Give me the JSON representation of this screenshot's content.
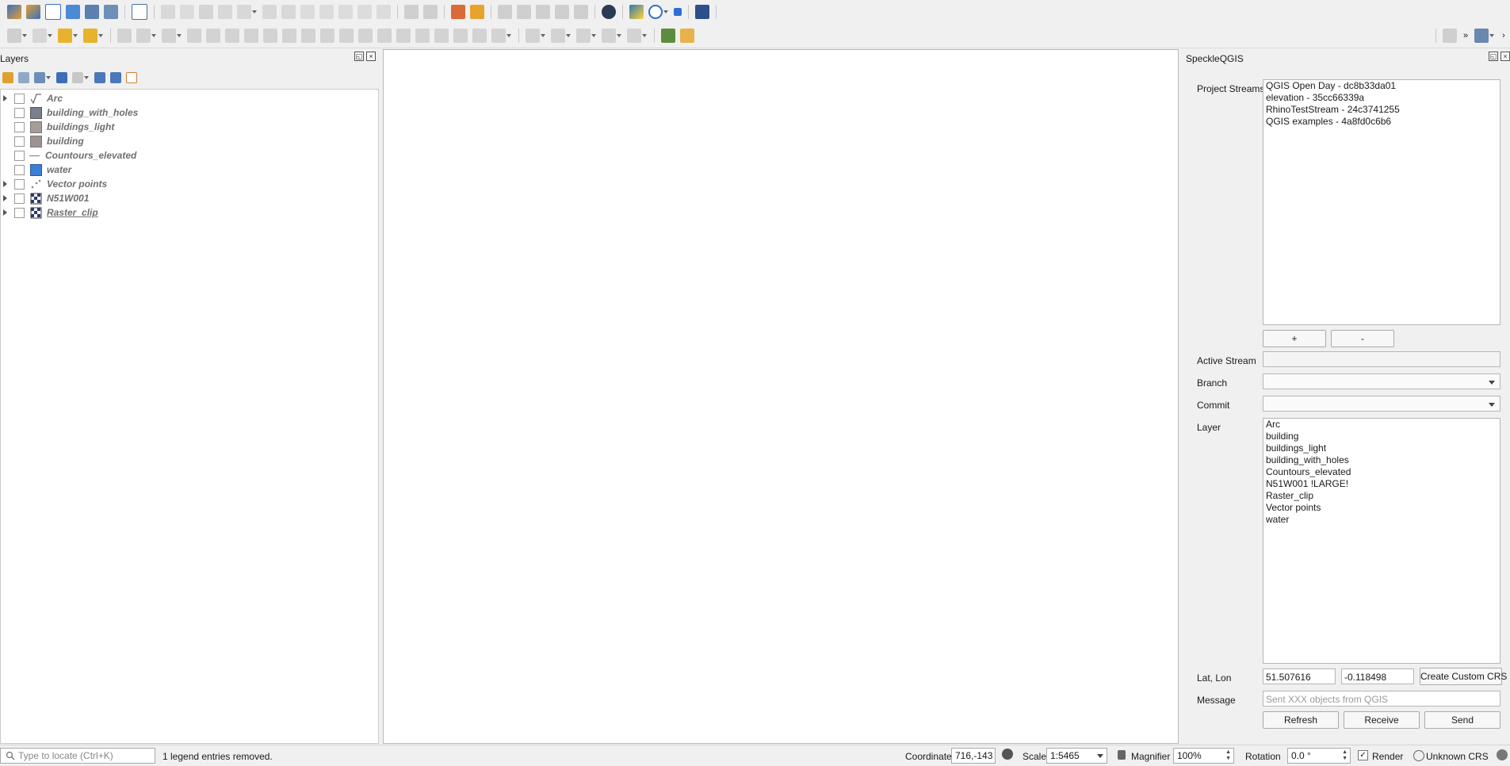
{
  "layers_panel": {
    "title": "Layers",
    "items": [
      {
        "name": "Arc",
        "expandable": true,
        "symbol": "line-polyline-icon"
      },
      {
        "name": "building_with_holes",
        "expandable": false,
        "symbol": "polygon-fill-icon",
        "color": "#7a7f8c"
      },
      {
        "name": "buildings_light",
        "expandable": false,
        "symbol": "polygon-fill-icon",
        "color": "#a79c97"
      },
      {
        "name": "building",
        "expandable": false,
        "symbol": "polygon-fill-icon",
        "color": "#9c9291"
      },
      {
        "name": "Countours_elevated",
        "expandable": false,
        "symbol": "line-icon"
      },
      {
        "name": "water",
        "expandable": false,
        "symbol": "polygon-fill-icon",
        "color": "#3b7fd6"
      },
      {
        "name": "Vector points",
        "expandable": true,
        "symbol": "points-icon"
      },
      {
        "name": "N51W001",
        "expandable": true,
        "symbol": "raster-icon"
      },
      {
        "name": "Raster_clip",
        "expandable": true,
        "symbol": "raster-icon"
      }
    ]
  },
  "speckle": {
    "title": "SpeckleQGIS",
    "project_streams_label": "Project Streams",
    "streams": [
      "QGIS Open Day - dc8b33da01",
      "elevation - 35cc66339a",
      "RhinoTestStream - 24c3741255",
      "QGIS examples - 4a8fd0c6b6"
    ],
    "add_label": "+",
    "remove_label": "-",
    "active_stream_label": "Active Stream",
    "active_stream_value": "",
    "branch_label": "Branch",
    "branch_value": "",
    "commit_label": "Commit",
    "commit_value": "",
    "layer_label": "Layer",
    "layers": [
      "Arc",
      "building",
      "buildings_light",
      "building_with_holes",
      "Countours_elevated",
      "N51W001 !LARGE!",
      "Raster_clip",
      "Vector points",
      "water"
    ],
    "latlon_label": "Lat, Lon",
    "lat_value": "51.507616",
    "lon_value": "-0.118498",
    "custom_crs_label": "Create Custom CRS",
    "message_label": "Message",
    "message_placeholder": "Sent XXX objects from QGIS",
    "refresh_label": "Refresh",
    "receive_label": "Receive",
    "send_label": "Send"
  },
  "statusbar": {
    "locator_placeholder": "Type to locate (Ctrl+K)",
    "message": "1 legend entries removed.",
    "coordinate_label": "Coordinate",
    "coordinate_value": "716,-143",
    "scale_label": "Scale",
    "scale_value": "1:5465",
    "magnifier_label": "Magnifier",
    "magnifier_value": "100%",
    "rotation_label": "Rotation",
    "rotation_value": "0.0 °",
    "render_label": "Render",
    "crs_label": "Unknown CRS"
  },
  "colors": {
    "toolbar_bg": "#f0f0f0",
    "accent_blue": "#2f6fcf"
  }
}
